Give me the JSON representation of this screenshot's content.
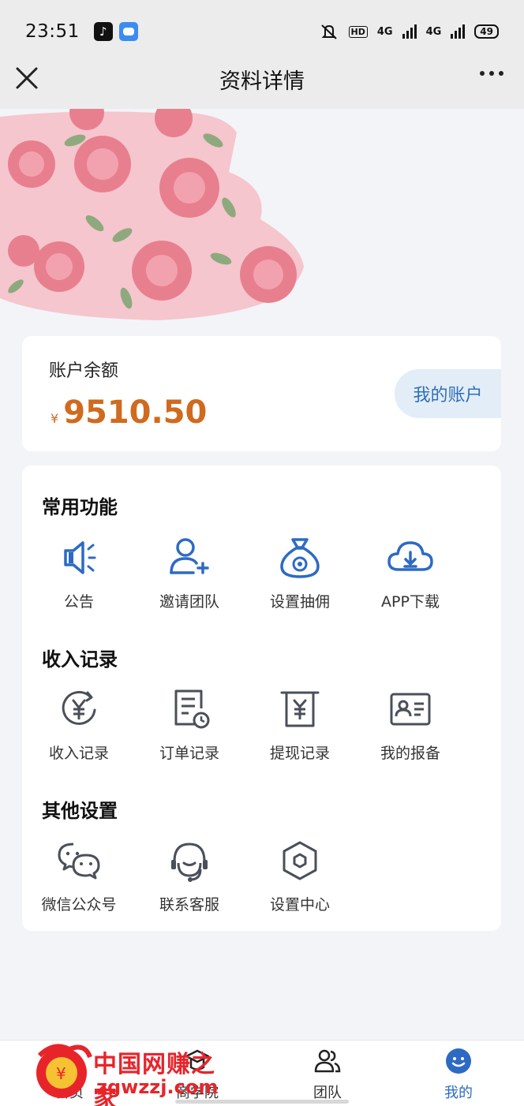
{
  "status_bar": {
    "time": "23:51",
    "network_1": "4G",
    "network_2": "4G",
    "hd_label": "HD",
    "battery": "49"
  },
  "nav": {
    "title": "资料详情"
  },
  "balance": {
    "label": "账户余额",
    "currency": "¥",
    "amount": "9510.50",
    "my_account_label": "我的账户"
  },
  "sections": {
    "common": {
      "title": "常用功能",
      "items": [
        {
          "label": "公告",
          "icon": "megaphone-icon"
        },
        {
          "label": "邀请团队",
          "icon": "add-user-icon"
        },
        {
          "label": "设置抽佣",
          "icon": "money-bag-icon"
        },
        {
          "label": "APP下载",
          "icon": "cloud-download-icon"
        }
      ]
    },
    "income": {
      "title": "收入记录",
      "items": [
        {
          "label": "收入记录",
          "icon": "yen-refresh-icon"
        },
        {
          "label": "订单记录",
          "icon": "order-clock-icon"
        },
        {
          "label": "提现记录",
          "icon": "withdraw-icon"
        },
        {
          "label": "我的报备",
          "icon": "id-card-icon"
        }
      ]
    },
    "other": {
      "title": "其他设置",
      "items": [
        {
          "label": "微信公众号",
          "icon": "wechat-icon"
        },
        {
          "label": "联系客服",
          "icon": "headset-icon"
        },
        {
          "label": "设置中心",
          "icon": "hexagon-settings-icon"
        }
      ]
    }
  },
  "tab_bar": {
    "tabs": [
      {
        "label": "首页"
      },
      {
        "label": "商学院"
      },
      {
        "label": "团队"
      },
      {
        "label": "我的"
      }
    ]
  },
  "watermark": {
    "text": "中国网赚之家",
    "sub": "zgwzzj.com"
  },
  "colors": {
    "accent_blue": "#2d6ac4",
    "amount_orange": "#d06a1e",
    "page_bg": "#f2f4f8"
  }
}
